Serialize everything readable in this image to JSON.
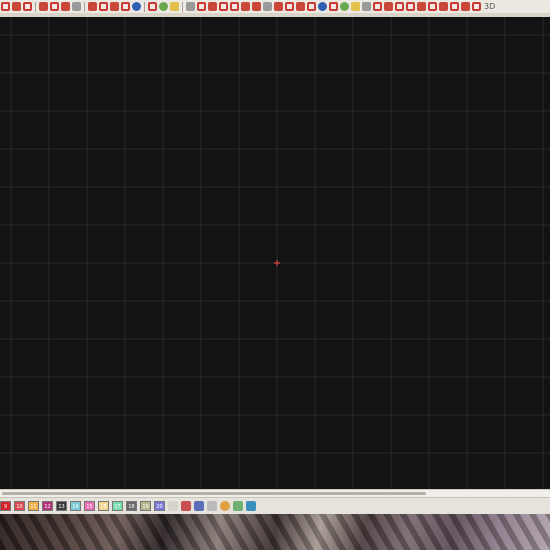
{
  "window": {
    "title": ""
  },
  "toolbar": {
    "label_3d": "3D",
    "icons": [
      "stitch-tool-icon",
      "satin-tool-icon",
      "fill-tool-icon",
      "run-tool-icon",
      "cross-stitch-icon",
      "lettering-icon",
      "monogram-icon",
      "circle-tool-icon",
      "convert-icon",
      "node-edit-icon",
      "appliqué-icon",
      "gradient-icon",
      "moon-icon",
      "color-wheel-icon",
      "thread-icon",
      "pattern-icon",
      "cut-icon",
      "zoom-icon",
      "redo-icon",
      "undo-icon",
      "3d-view-icon"
    ]
  },
  "canvas": {
    "background": "#131313",
    "grid_color": "#2a2a2a",
    "origin_marker_color": "#d8464a"
  },
  "palette": {
    "swatches": [
      {
        "label": "9",
        "color": "#d4212a"
      },
      {
        "label": "10",
        "color": "#d94a52"
      },
      {
        "label": "11",
        "color": "#f0b048"
      },
      {
        "label": "12",
        "color": "#b0337c"
      },
      {
        "label": "13",
        "color": "#3c3c3c"
      },
      {
        "label": "14",
        "color": "#7fc8d8"
      },
      {
        "label": "15",
        "color": "#e86db4"
      },
      {
        "label": "16",
        "color": "#f2d68c"
      },
      {
        "label": "17",
        "color": "#78dca8"
      },
      {
        "label": "18",
        "color": "#6a6a6a"
      },
      {
        "label": "19",
        "color": "#b9b48a"
      },
      {
        "label": "20",
        "color": "#7a78d8"
      }
    ]
  }
}
